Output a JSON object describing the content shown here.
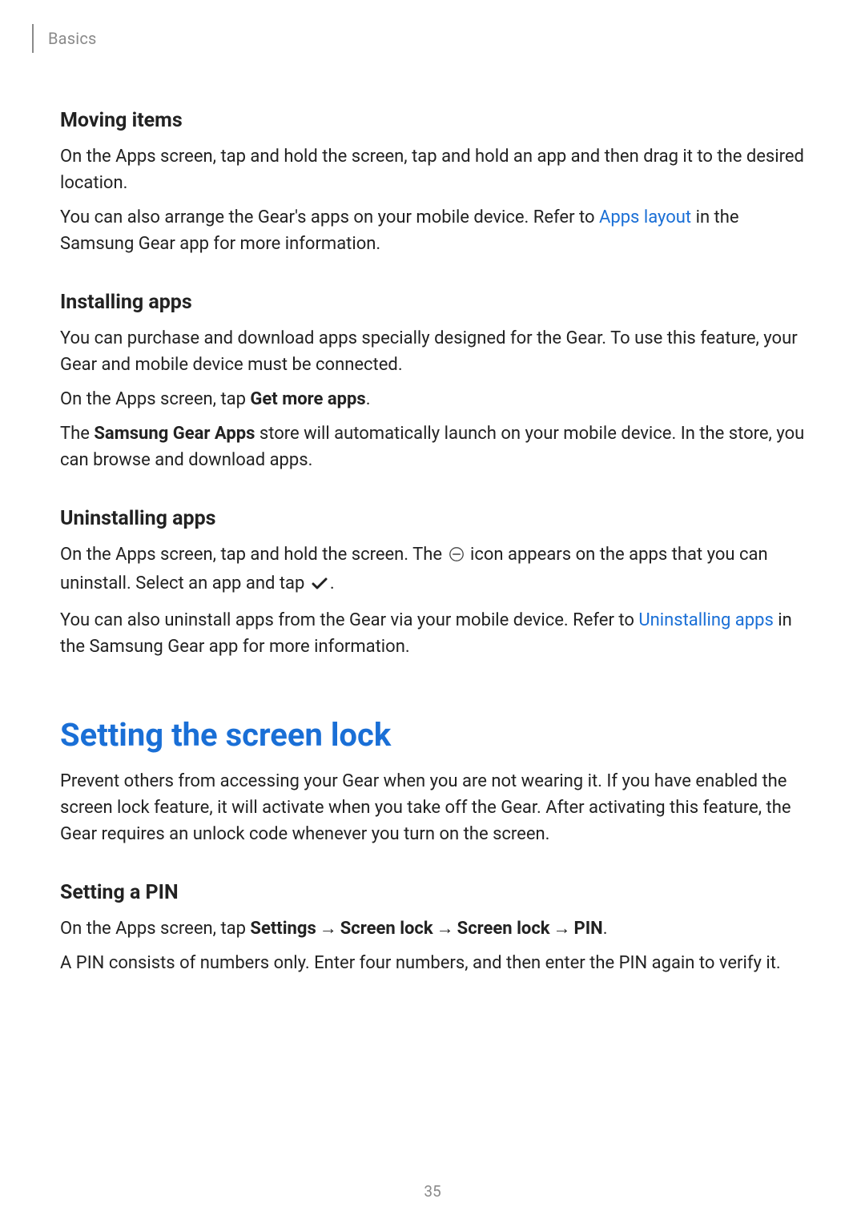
{
  "header": {
    "section_label": "Basics"
  },
  "moving_items": {
    "heading": "Moving items",
    "p1": "On the Apps screen, tap and hold the screen, tap and hold an app and then drag it to the desired location.",
    "p2a": "You can also arrange the Gear's apps on your mobile device. Refer to ",
    "p2_link": "Apps layout",
    "p2b": " in the Samsung Gear app for more information."
  },
  "installing_apps": {
    "heading": "Installing apps",
    "p1": "You can purchase and download apps specially designed for the Gear. To use this feature, your Gear and mobile device must be connected.",
    "p2a": "On the Apps screen, tap ",
    "p2_bold": "Get more apps",
    "p2b": ".",
    "p3a": "The ",
    "p3_bold": "Samsung Gear Apps",
    "p3b": " store will automatically launch on your mobile device. In the store, you can browse and download apps."
  },
  "uninstalling_apps": {
    "heading": "Uninstalling apps",
    "p1a": "On the Apps screen, tap and hold the screen. The ",
    "p1b": " icon appears on the apps that you can uninstall. Select an app and tap ",
    "p1c": ".",
    "p2a": "You can also uninstall apps from the Gear via your mobile device. Refer to ",
    "p2_link": "Uninstalling apps",
    "p2b": " in the Samsung Gear app for more information."
  },
  "screen_lock": {
    "title": "Setting the screen lock",
    "intro": "Prevent others from accessing your Gear when you are not wearing it. If you have enabled the screen lock feature, it will activate when you take off the Gear. After activating this feature, the Gear requires an unlock code whenever you turn on the screen.",
    "pin_heading": "Setting a PIN",
    "pin_p1a": "On the Apps screen, tap ",
    "pin_p1_settings": "Settings",
    "pin_p1_screenlock1": "Screen lock",
    "pin_p1_screenlock2": "Screen lock",
    "pin_p1_pin": "PIN",
    "pin_p1b": ".",
    "pin_p2": "A PIN consists of numbers only. Enter four numbers, and then enter the PIN again to verify it."
  },
  "arrow": "→",
  "page_number": "35"
}
